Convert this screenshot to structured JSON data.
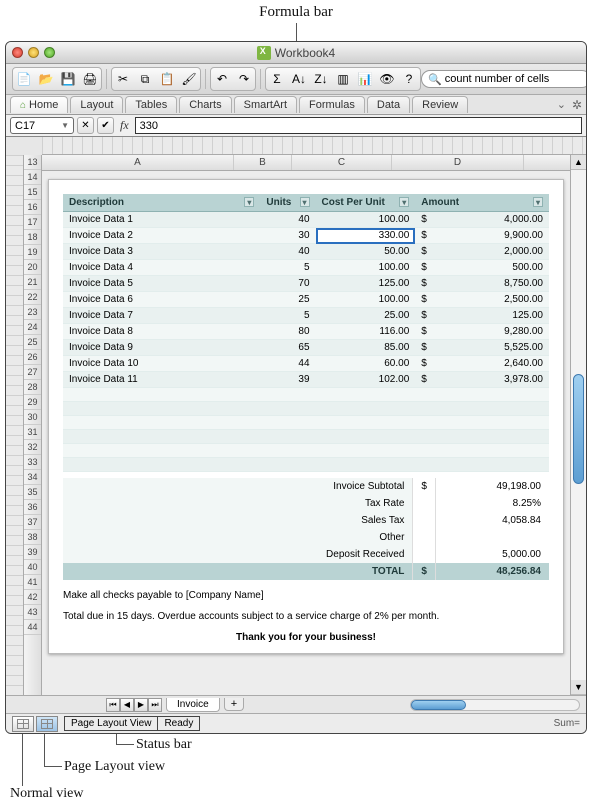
{
  "callouts": {
    "top": "Formula bar",
    "status_bar": "Status bar",
    "page_layout_view": "Page Layout view",
    "normal_view": "Normal view"
  },
  "window": {
    "title": "Workbook4"
  },
  "toolbar": {
    "search_placeholder": "",
    "search_value": "count number of cells"
  },
  "ribbon": {
    "tabs": [
      "Home",
      "Layout",
      "Tables",
      "Charts",
      "SmartArt",
      "Formulas",
      "Data",
      "Review"
    ],
    "active": 0
  },
  "formula_bar": {
    "cell_ref": "C17",
    "fx_label": "fx",
    "formula": "330"
  },
  "column_headers": [
    "A",
    "B",
    "C",
    "D"
  ],
  "row_headers_start": 13,
  "row_headers_end": 44,
  "invoice": {
    "headers": [
      "Description",
      "Units",
      "Cost Per Unit",
      "Amount"
    ],
    "currency": "$",
    "rows": [
      {
        "desc": "Invoice Data 1",
        "units": 40,
        "cost": "100.00",
        "amount": "4,000.00"
      },
      {
        "desc": "Invoice Data 2",
        "units": 30,
        "cost": "330.00",
        "amount": "9,900.00"
      },
      {
        "desc": "Invoice Data 3",
        "units": 40,
        "cost": "50.00",
        "amount": "2,000.00"
      },
      {
        "desc": "Invoice Data 4",
        "units": 5,
        "cost": "100.00",
        "amount": "500.00"
      },
      {
        "desc": "Invoice Data 5",
        "units": 70,
        "cost": "125.00",
        "amount": "8,750.00"
      },
      {
        "desc": "Invoice Data 6",
        "units": 25,
        "cost": "100.00",
        "amount": "2,500.00"
      },
      {
        "desc": "Invoice Data 7",
        "units": 5,
        "cost": "25.00",
        "amount": "125.00"
      },
      {
        "desc": "Invoice Data 8",
        "units": 80,
        "cost": "116.00",
        "amount": "9,280.00"
      },
      {
        "desc": "Invoice Data 9",
        "units": 65,
        "cost": "85.00",
        "amount": "5,525.00"
      },
      {
        "desc": "Invoice Data 10",
        "units": 44,
        "cost": "60.00",
        "amount": "2,640.00"
      },
      {
        "desc": "Invoice Data 11",
        "units": 39,
        "cost": "102.00",
        "amount": "3,978.00"
      }
    ],
    "totals": [
      {
        "label": "Invoice Subtotal",
        "cur": "$",
        "value": "49,198.00"
      },
      {
        "label": "Tax Rate",
        "cur": "",
        "value": "8.25%"
      },
      {
        "label": "Sales Tax",
        "cur": "",
        "value": "4,058.84"
      },
      {
        "label": "Other",
        "cur": "",
        "value": ""
      },
      {
        "label": "Deposit Received",
        "cur": "",
        "value": "5,000.00"
      }
    ],
    "grand_total_label": "TOTAL",
    "grand_total_cur": "$",
    "grand_total": "48,256.84",
    "note_line1": "Make all checks payable to [Company Name]",
    "note_line2": "Total due in 15 days. Overdue accounts subject to a service charge of 2% per month.",
    "thanks": "Thank you for your business!"
  },
  "sheet_tabs": {
    "active": "Invoice"
  },
  "status_bar": {
    "view_label": "Page Layout View",
    "state": "Ready",
    "sum": "Sum="
  }
}
